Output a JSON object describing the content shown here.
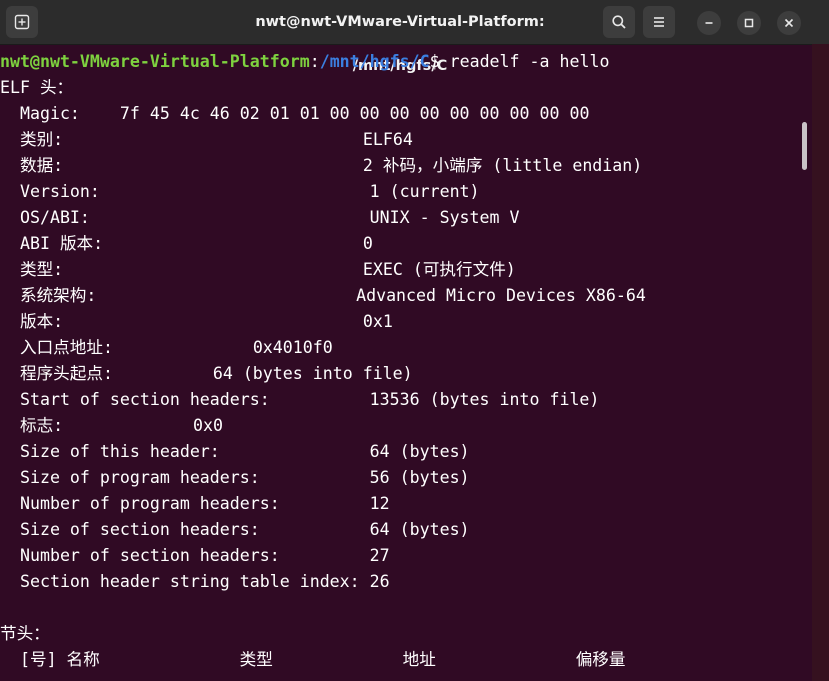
{
  "window": {
    "title": "nwt@nwt-VMware-Virtual-Platform: /mnt/hgfs/C"
  },
  "icons": {
    "new_tab": "new-tab-icon",
    "search": "search-icon",
    "menu": "hamburger-menu-icon",
    "minimize": "minimize-icon",
    "maximize": "maximize-icon",
    "close": "close-icon"
  },
  "colors": {
    "background": "#300a24",
    "titlebar": "#2c2c2c",
    "prompt_user": "#7ed23f",
    "prompt_path": "#3b7fe0",
    "text": "#ffffff"
  },
  "terminal": {
    "prompt": {
      "user_host": "nwt@nwt-VMware-Virtual-Platform",
      "colon": ":",
      "path": "/mnt/hgfs/C",
      "symbol": "$ ",
      "command": "readelf -a hello"
    },
    "elf_header_title": "ELF 头：",
    "rows": [
      {
        "label": "  Magic:    ",
        "value": "7f 45 4c 46 02 01 01 00 00 00 00 00 00 00 00 00"
      },
      {
        "label": "  类别:                              ",
        "value": "ELF64"
      },
      {
        "label": "  数据:                              ",
        "value": "2 补码，小端序 (little endian)"
      },
      {
        "label": "  Version:                           ",
        "value": "1 (current)"
      },
      {
        "label": "  OS/ABI:                            ",
        "value": "UNIX - System V"
      },
      {
        "label": "  ABI 版本:                          ",
        "value": "0"
      },
      {
        "label": "  类型:                              ",
        "value": "EXEC (可执行文件)"
      },
      {
        "label": "  系统架构:                          ",
        "value": "Advanced Micro Devices X86-64"
      },
      {
        "label": "  版本:                              ",
        "value": "0x1"
      },
      {
        "label": "  入口点地址:              ",
        "value": "0x4010f0"
      },
      {
        "label": "  程序头起点:          ",
        "value": "64 (bytes into file)"
      },
      {
        "label": "  Start of section headers:          ",
        "value": "13536 (bytes into file)"
      },
      {
        "label": "  标志:             ",
        "value": "0x0"
      },
      {
        "label": "  Size of this header:               ",
        "value": "64 (bytes)"
      },
      {
        "label": "  Size of program headers:           ",
        "value": "56 (bytes)"
      },
      {
        "label": "  Number of program headers:         ",
        "value": "12"
      },
      {
        "label": "  Size of section headers:           ",
        "value": "64 (bytes)"
      },
      {
        "label": "  Number of section headers:         ",
        "value": "27"
      },
      {
        "label": "  Section header string table index: ",
        "value": "26"
      }
    ],
    "section_title": "节头：",
    "section_columns": "  [号] 名称              类型             地址              偏移量"
  }
}
